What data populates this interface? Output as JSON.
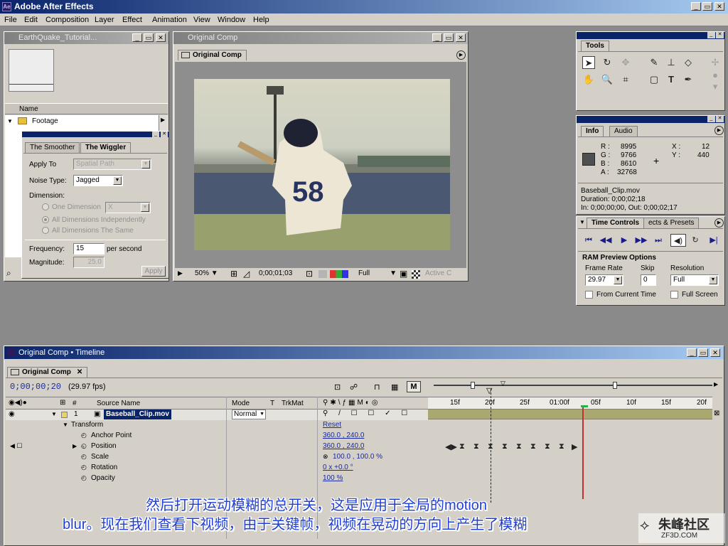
{
  "app": {
    "title": "Adobe After Effects",
    "menu": [
      "File",
      "Edit",
      "Composition",
      "Layer",
      "Effect",
      "Animation",
      "View",
      "Window",
      "Help"
    ]
  },
  "project": {
    "title": "EarthQuake_Tutorial...",
    "col_name": "Name",
    "folder": "Footage"
  },
  "wiggler": {
    "tab1": "The Smoother",
    "tab2": "The Wiggler",
    "apply_to_label": "Apply To",
    "apply_to_value": "Spatial Path",
    "noise_label": "Noise Type:",
    "noise_value": "Jagged",
    "dimension_label": "Dimension:",
    "opt1": "One Dimension",
    "opt1_value": "X",
    "opt2": "All Dimensions Independently",
    "opt3": "All Dimensions The Same",
    "freq_label": "Frequency:",
    "freq_value": "15",
    "freq_unit": "per second",
    "mag_label": "Magnitude:",
    "mag_value": "25.0",
    "apply_btn": "Apply"
  },
  "comp": {
    "window_title": "Original Comp",
    "tab": "Original Comp",
    "zoom": "50%",
    "time": "0;00;01;03",
    "resolution": "Full",
    "camera": "Active C"
  },
  "tools": {
    "title": "Tools"
  },
  "info": {
    "tab1": "Info",
    "tab2": "Audio",
    "r_label": "R :",
    "r": "8995",
    "g_label": "G :",
    "g": "9766",
    "b_label": "B :",
    "b": "8610",
    "a_label": "A :",
    "a": "32768",
    "x_label": "X :",
    "x": "12",
    "y_label": "Y :",
    "y": "440",
    "clip": "Baseball_Clip.mov",
    "duration": "Duration: 0;00;02;18",
    "inout": "In: 0;00;00;00, Out: 0;00;02;17"
  },
  "time_controls": {
    "tab1": "Time Controls",
    "tab2": "ects & Presets",
    "ram_title": "RAM Preview Options",
    "frame_rate_label": "Frame Rate",
    "frame_rate": "29.97",
    "skip_label": "Skip",
    "skip": "0",
    "resolution_label": "Resolution",
    "resolution": "Full",
    "from_current": "From Current Time",
    "full_screen": "Full Screen"
  },
  "timeline": {
    "window_title": "Original Comp • Timeline",
    "tab": "Original Comp",
    "current_time": "0;00;00;20",
    "fps": "(29.97 fps)",
    "col_num": "#",
    "col_source": "Source Name",
    "col_mode": "Mode",
    "col_t": "T",
    "col_trkmat": "TrkMat",
    "layer_num": "1",
    "layer_name": "Baseball_Clip.mov",
    "layer_mode": "Normal",
    "transform": "Transform",
    "reset": "Reset",
    "props": [
      {
        "name": "Anchor Point",
        "value": "360.0 , 240.0"
      },
      {
        "name": "Position",
        "value": "360.0 , 240.0"
      },
      {
        "name": "Scale",
        "value": "100.0 , 100.0 %"
      },
      {
        "name": "Rotation",
        "value": "0 x +0.0 °"
      },
      {
        "name": "Opacity",
        "value": "100 %"
      }
    ],
    "ruler": [
      "15f",
      "20f",
      "25f",
      "01:00f",
      "05f",
      "10f",
      "15f",
      "20f"
    ]
  },
  "subtitle": {
    "line1": "然后打开运动模糊的总开关，这是应用于全局的motion",
    "line2": "blur。现在我们查看下视频，由于关键帧，视频在晃动的方向上产生了模糊"
  },
  "watermark": {
    "name": "朱峰社区",
    "url": "ZF3D.COM"
  }
}
